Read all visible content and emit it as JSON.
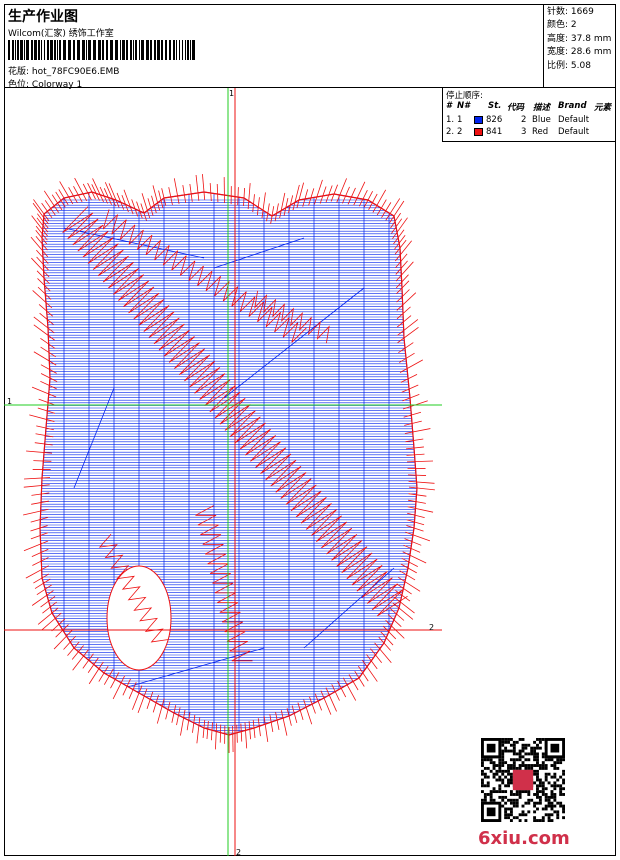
{
  "header": {
    "title": "生产作业图",
    "company": "Wilcom(汇家) 绣饰工作室",
    "pattern_label": "花版:",
    "pattern_value": "hot_78FC90E6.EMB",
    "colorway_label": "色位:",
    "colorway_value": "Colorway 1"
  },
  "stats": {
    "stitches_label": "针数:",
    "stitches_value": "1669",
    "colors_label": "颜色:",
    "colors_value": "2",
    "height_label": "高度:",
    "height_value": "37.8 mm",
    "width_label": "宽度:",
    "width_value": "28.6 mm",
    "scale_label": "比例:",
    "scale_value": "5.08"
  },
  "stop_sequence": {
    "title": "停止顺序:",
    "headers": [
      "#",
      "N#",
      "St.",
      "代码",
      "描述",
      "Brand",
      "元素"
    ],
    "rows": [
      {
        "num": "1.",
        "needle": "1",
        "color": "#0022ee",
        "stitches": "826",
        "code": "2",
        "desc": "Blue",
        "brand": "Default"
      },
      {
        "num": "2.",
        "needle": "2",
        "color": "#ee1111",
        "stitches": "841",
        "code": "3",
        "desc": "Red",
        "brand": "Default"
      }
    ]
  },
  "axes": {
    "v_top": "1",
    "v_bottom": "2",
    "h_left": "1",
    "h_right": "2"
  },
  "colors": {
    "fill_stitch": "#0022ee",
    "outline_stitch": "#ee1111",
    "axis1": "#22cc22",
    "axis2": "#ee1111"
  },
  "watermark": "6xiu.com"
}
